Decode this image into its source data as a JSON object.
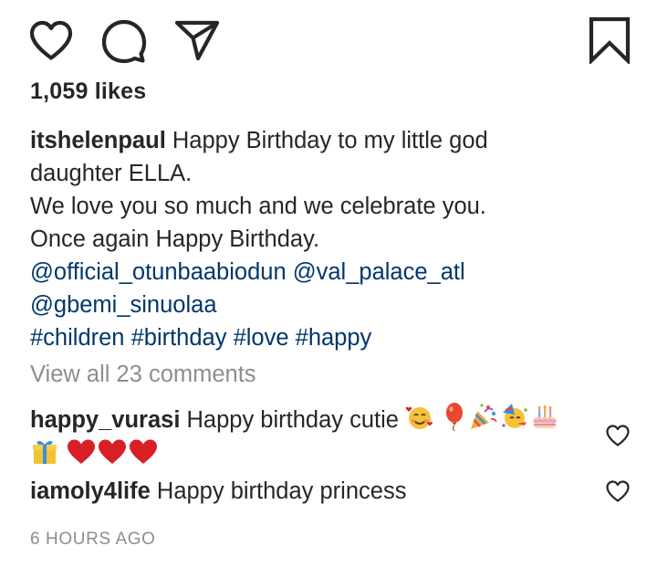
{
  "post": {
    "likes_text": "1,059 likes",
    "caption": {
      "username": "itshelenpaul",
      "line1_text": " Happy Birthday to my little god",
      "line2_text": "daughter ELLA.",
      "line3_text": "We love you so much and we celebrate you.",
      "line4_text": "Once again Happy Birthday.",
      "mention_1": "@official_otunbaabiodun",
      "mention_2": "@val_palace_atl",
      "mention_3": "@gbemi_sinuolaa",
      "hashtags": [
        "#children",
        "#birthday",
        "#love",
        "#happy"
      ]
    },
    "view_comments_text": "View all 23 comments",
    "comments": [
      {
        "username": "happy_vurasi",
        "text": " Happy birthday cutie ",
        "emojis": [
          "smiling-face-with-hearts",
          "balloon",
          "party-popper",
          "partying-face",
          "birthday-cake",
          "wrapped-gift",
          "red-heart",
          "red-heart",
          "red-heart"
        ]
      },
      {
        "username": "iamoly4life",
        "text": " Happy birthday princess"
      }
    ],
    "timestamp": "6 HOURS AGO"
  },
  "icons": {
    "like": "heart-outline-icon",
    "comment": "comment-bubble-icon",
    "share": "paper-plane-icon",
    "save": "bookmark-outline-icon",
    "comment_like": "heart-outline-icon"
  },
  "colors": {
    "text": "#262626",
    "link": "#00376b",
    "muted": "#8e8e8e",
    "heart_red": "#e0242b"
  }
}
